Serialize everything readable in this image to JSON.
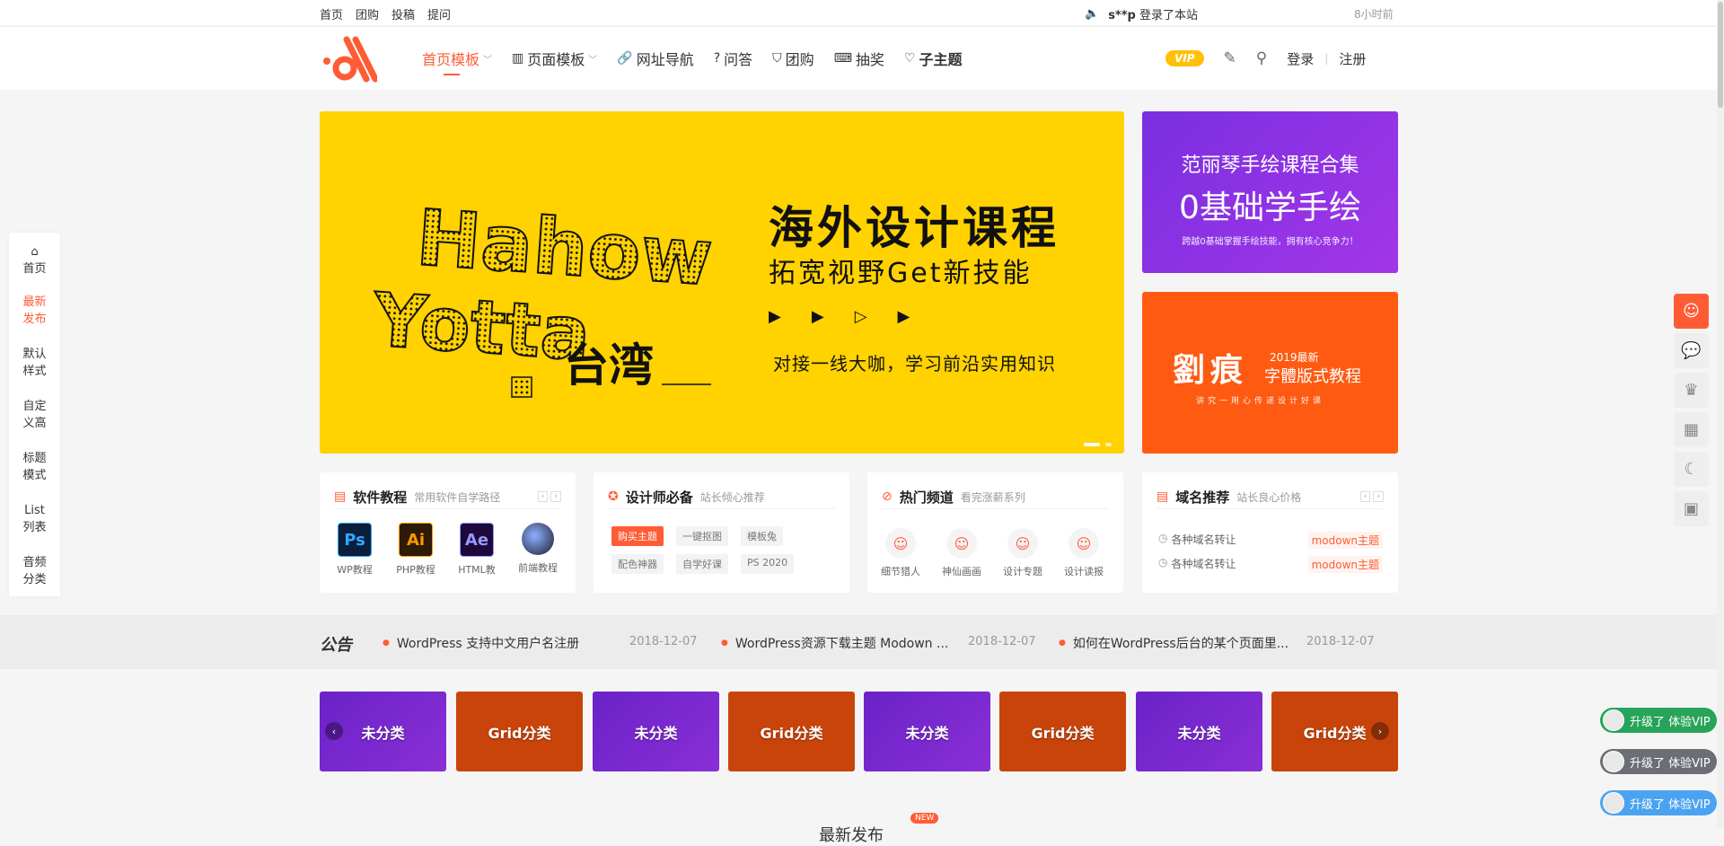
{
  "topbar": {
    "links": [
      "首页",
      "团购",
      "投稿",
      "提问"
    ],
    "notice_user": "s**p",
    "notice_text": "登录了本站",
    "time": "8小时前"
  },
  "nav": {
    "items": [
      {
        "label": "首页模板",
        "icon": "none",
        "chevron": true,
        "active": true
      },
      {
        "label": "页面模板",
        "icon": "columns-icon",
        "chevron": true
      },
      {
        "label": "网址导航",
        "icon": "link-icon"
      },
      {
        "label": "问答",
        "icon": "question-icon"
      },
      {
        "label": "团购",
        "icon": "bag-icon"
      },
      {
        "label": "抽奖",
        "icon": "gamepad-icon"
      },
      {
        "label": "子主题",
        "icon": "heart-icon"
      }
    ],
    "vip": "VIP",
    "login": "登录",
    "sep": "|",
    "register": "注册"
  },
  "banner": {
    "art_line1": "Hahow",
    "art_line2": "Yotta",
    "art_line3": "台湾",
    "title": "海外设计课程",
    "subtitle": "拓宽视野Get新技能",
    "tagline": "对接一线大咖，学习前沿实用知识"
  },
  "side1": {
    "line1": "范丽琴手绘课程合集",
    "line2": "0基础学手绘",
    "line3": "跨越0基础掌握手绘技能，拥有核心竞争力！"
  },
  "side2": {
    "line1": "劉痕",
    "line2": "2019最新",
    "line3": "字體版式教程",
    "line4": "讲究一用心传递设计好课"
  },
  "cards": {
    "software": {
      "title": "软件教程",
      "subtitle": "常用软件自学路径",
      "apps": [
        {
          "abbr": "Ps",
          "label": "WP教程",
          "bg": "#0b1e3a",
          "fg": "#31a8ff"
        },
        {
          "abbr": "Ai",
          "label": "PHP教程",
          "bg": "#2e1a05",
          "fg": "#ff9a00"
        },
        {
          "abbr": "Ae",
          "label": "HTML教",
          "bg": "#1c0a3a",
          "fg": "#9999ff"
        },
        {
          "abbr": "",
          "label": "前端教程",
          "bg": "#2b2b3a",
          "fg": "#8fb0ff"
        }
      ]
    },
    "designer": {
      "title": "设计师必备",
      "subtitle": "站长倾心推荐",
      "tags": [
        "购买主题",
        "一键抠图",
        "模板兔",
        "配色神器",
        "自学好课",
        "PS 2020"
      ]
    },
    "hot": {
      "title": "热门频道",
      "subtitle": "看完涨薪系列",
      "items": [
        "细节猎人",
        "神仙画画",
        "设计专题",
        "设计读报"
      ]
    },
    "domain": {
      "title": "域名推荐",
      "subtitle": "站长良心价格",
      "items": [
        {
          "label": "各种域名转让",
          "value": "modown主题"
        },
        {
          "label": "各种域名转让",
          "value": "modown主题"
        }
      ]
    }
  },
  "announcement": {
    "label": "公告",
    "items": [
      {
        "title": "WordPress 支持中文用户名注册",
        "date": "2018-12-07"
      },
      {
        "title": "WordPress资源下载主题 Modown ...",
        "date": "2018-12-07"
      },
      {
        "title": "如何在WordPress后台的某个页面里...",
        "date": "2018-12-07"
      }
    ]
  },
  "grid_items": [
    "未分类",
    "Grid分类",
    "未分类",
    "Grid分类",
    "未分类",
    "Grid分类",
    "未分类",
    "Grid分类"
  ],
  "section": {
    "title": "最新发布",
    "badge": "NEW"
  },
  "left_nav": [
    "首页",
    "最新\n发布",
    "默认\n样式",
    "自定\n义高",
    "标题\n模式",
    "List\n列表",
    "音频\n分类"
  ],
  "right_tools": [
    "headset-icon",
    "wechat-icon",
    "crown-icon",
    "calendar-icon",
    "moon-icon",
    "qrcode-icon"
  ],
  "vip_pills": [
    {
      "label": "升级了 体验VIP",
      "color": "#27a35a"
    },
    {
      "label": "升级了 体验VIP",
      "color": "#6b6f75"
    },
    {
      "label": "升级了 体验VIP",
      "color": "#4aa3f0"
    }
  ],
  "colors": {
    "accent": "#ff5c35",
    "banner_bg": "#ffd200",
    "vip": "#ffc107"
  }
}
